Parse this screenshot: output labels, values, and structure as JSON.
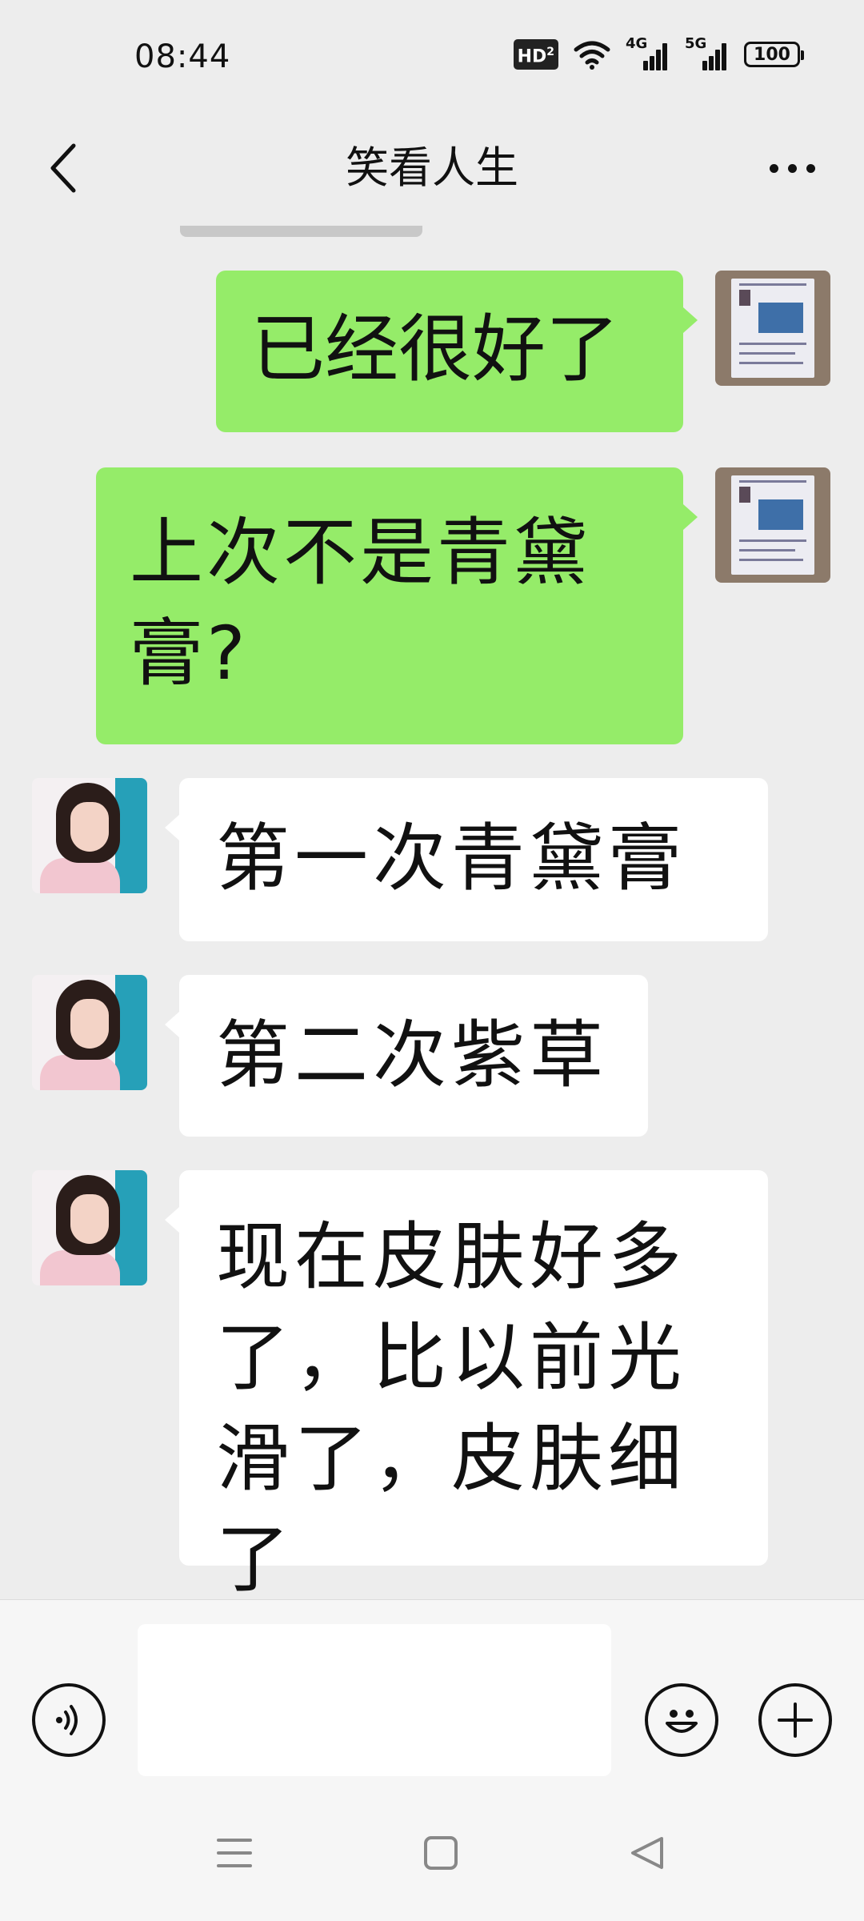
{
  "status_bar": {
    "time": "08:44",
    "hd_label": "HD",
    "hd_sub": "2",
    "signal_1": "4G",
    "signal_2": "5G",
    "battery": "100"
  },
  "header": {
    "title": "笑看人生"
  },
  "messages": [
    {
      "sender": "self",
      "text": "已经很好了"
    },
    {
      "sender": "self",
      "text": "上次不是青黛膏?"
    },
    {
      "sender": "other",
      "text": "第一次青黛膏"
    },
    {
      "sender": "other",
      "text": "第二次紫草"
    },
    {
      "sender": "other",
      "text": "现在皮肤好多了，比以前光滑了，皮肤细了"
    }
  ],
  "input_bar": {
    "placeholder": ""
  },
  "icons": {
    "back": "chevron-left-icon",
    "more": "more-dots-icon",
    "voice": "voice-icon",
    "emoji": "emoji-icon",
    "plus": "plus-icon",
    "nav_menu": "menu-icon",
    "nav_home": "home-icon",
    "nav_back": "back-triangle-icon"
  },
  "colors": {
    "self_bubble": "#95ec69",
    "other_bubble": "#ffffff",
    "background": "#ededed"
  }
}
